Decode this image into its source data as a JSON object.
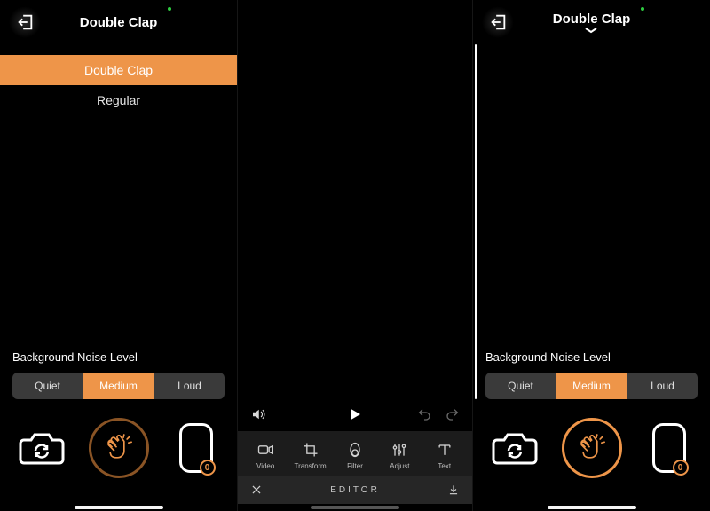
{
  "colors": {
    "accent": "#EE9549",
    "segbg": "#3a3a3a"
  },
  "screen1": {
    "title": "Double Clap",
    "options": [
      {
        "label": "Double Clap",
        "selected": true
      },
      {
        "label": "Regular",
        "selected": false
      }
    ],
    "noise": {
      "label": "Background Noise Level",
      "levels": [
        "Quiet",
        "Medium",
        "Loud"
      ],
      "selected": "Medium"
    },
    "counter": "0"
  },
  "screen2": {
    "tools": [
      {
        "name": "video-icon",
        "label": "Video"
      },
      {
        "name": "transform-icon",
        "label": "Transform"
      },
      {
        "name": "filter-icon",
        "label": "Filter"
      },
      {
        "name": "adjust-icon",
        "label": "Adjust"
      },
      {
        "name": "text-icon",
        "label": "Text"
      }
    ],
    "editor_label": "EDITOR"
  },
  "screen3": {
    "title": "Double Clap",
    "noise": {
      "label": "Background Noise Level",
      "levels": [
        "Quiet",
        "Medium",
        "Loud"
      ],
      "selected": "Medium"
    },
    "counter": "0"
  }
}
